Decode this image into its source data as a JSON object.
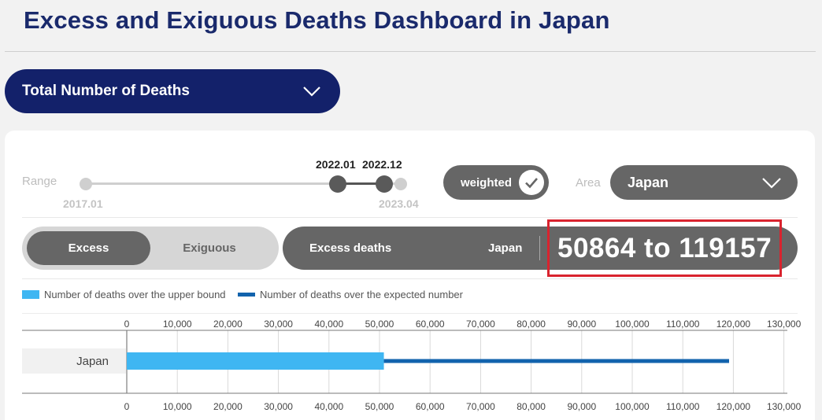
{
  "header": {
    "title": "Excess and Exiguous Deaths Dashboard in Japan"
  },
  "metric_select": {
    "label": "Total Number of Deaths",
    "icon": "chevron-down-icon"
  },
  "range": {
    "label": "Range",
    "min_label": "2017.01",
    "max_label": "2023.04",
    "selected_start": "2022.01",
    "selected_end": "2022.12"
  },
  "weighted": {
    "label": "weighted",
    "checked": true,
    "icon": "check-icon"
  },
  "area": {
    "label": "Area",
    "value": "Japan",
    "icon": "chevron-down-icon"
  },
  "mode_toggle": {
    "active": "Excess",
    "inactive": "Exiguous"
  },
  "result": {
    "kind": "Excess deaths",
    "place": "Japan",
    "value": "50864 to 119157"
  },
  "colors": {
    "upper_bound": "#3fb6f2",
    "expected": "#1263ad",
    "brand": "#13216a",
    "highlight": "#d9232e"
  },
  "legend": [
    {
      "label": "Number of deaths over the upper bound",
      "color": "#3fb6f2"
    },
    {
      "label": "Number of deaths over the expected number",
      "color": "#1263ad"
    }
  ],
  "chart_data": {
    "type": "bar",
    "orientation": "horizontal",
    "categories": [
      "Japan"
    ],
    "series": [
      {
        "name": "Number of deaths over the upper bound",
        "values": [
          50864
        ]
      },
      {
        "name": "Number of deaths over the expected number",
        "values": [
          119157
        ]
      }
    ],
    "xlim": [
      0,
      130000
    ],
    "ticks": [
      "0",
      "10,000",
      "20,000",
      "30,000",
      "40,000",
      "50,000",
      "60,000",
      "70,000",
      "80,000",
      "90,000",
      "100,000",
      "110,000",
      "120,000",
      "130,000"
    ],
    "grid": true
  }
}
